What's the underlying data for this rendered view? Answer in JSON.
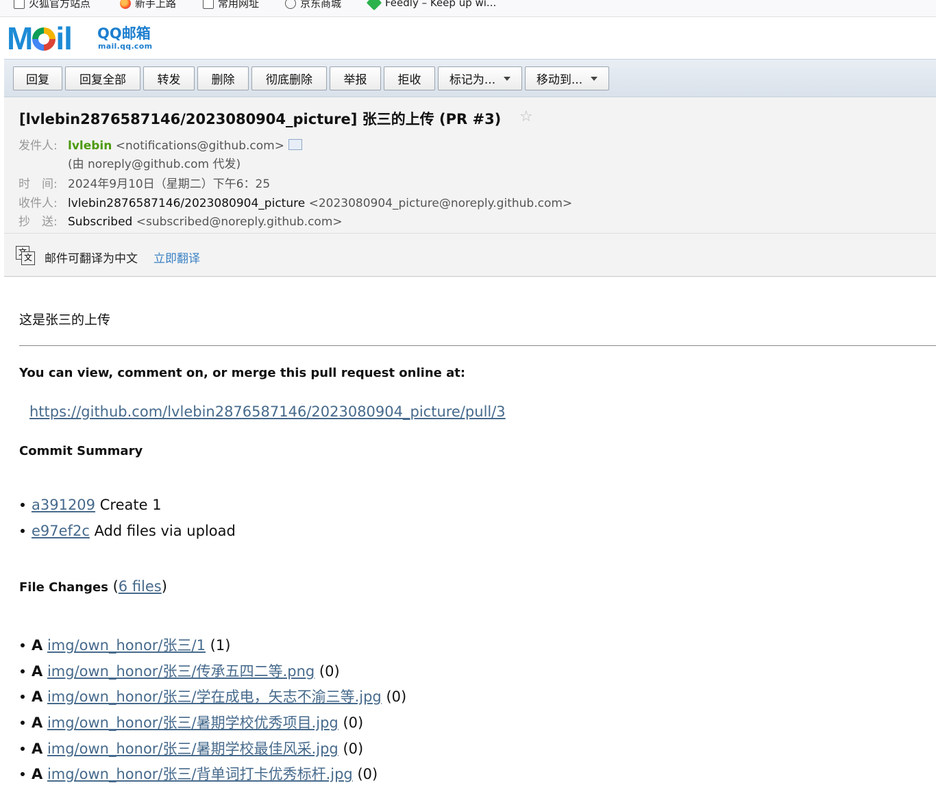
{
  "bookmarks": [
    {
      "icon": "page-icon",
      "label": "火狐官方站点"
    },
    {
      "icon": "firefox-icon",
      "label": "新手上路"
    },
    {
      "icon": "page-icon",
      "label": "常用网址"
    },
    {
      "icon": "globe-icon",
      "label": "京东商城"
    },
    {
      "icon": "feedly-icon",
      "label": "Feedly – Keep up wi..."
    }
  ],
  "logo": {
    "mail": "Mail",
    "name": "QQ邮箱",
    "url": "mail.qq.com"
  },
  "toolbar": {
    "reply": "回复",
    "reply_all": "回复全部",
    "forward": "转发",
    "delete": "删除",
    "delete_forever": "彻底删除",
    "report": "举报",
    "reject": "拒收",
    "mark_as": "标记为...",
    "move_to": "移动到..."
  },
  "email": {
    "subject": "[lvlebin2876587146/2023080904_picture] 张三的上传 (PR #3)",
    "from_label": "发件人:",
    "from_name": "lvlebin",
    "from_addr": "<notifications@github.com>",
    "on_behalf": "(由 noreply@github.com 代发)",
    "time_label": "时　间:",
    "time": "2024年9月10日（星期二）下午6：25",
    "to_label": "收件人:",
    "to_name": "lvlebin2876587146/2023080904_picture",
    "to_addr": "<2023080904_picture@noreply.github.com>",
    "cc_label": "抄　送:",
    "cc_name": "Subscribed",
    "cc_addr": "<subscribed@noreply.github.com>"
  },
  "translate": {
    "text": "邮件可翻译为中文",
    "link": "立即翻译"
  },
  "content": {
    "intro": "这是张三的上传",
    "view_line": "You can view, comment on, or merge this pull request online at:",
    "pr_url": "https://github.com/lvlebin2876587146/2023080904_picture/pull/3",
    "commit_summary": "Commit Summary",
    "commits": [
      {
        "sha": "a391209",
        "msg": "Create 1"
      },
      {
        "sha": "e97ef2c",
        "msg": "Add files via upload"
      }
    ],
    "file_changes": "File Changes",
    "file_changes_link": "6 files",
    "files": [
      {
        "type": "A",
        "path": "img/own_honor/张三/1",
        "count": "(1)"
      },
      {
        "type": "A",
        "path": "img/own_honor/张三/传承五四二等.png",
        "count": "(0)"
      },
      {
        "type": "A",
        "path": "img/own_honor/张三/学在成电，矢志不渝三等.jpg",
        "count": "(0)"
      },
      {
        "type": "A",
        "path": "img/own_honor/张三/暑期学校优秀项目.jpg",
        "count": "(0)"
      },
      {
        "type": "A",
        "path": "img/own_honor/张三/暑期学校最佳风采.jpg",
        "count": "(0)"
      },
      {
        "type": "A",
        "path": "img/own_honor/张三/背单词打卡优秀标杆.jpg",
        "count": "(0)"
      }
    ]
  }
}
